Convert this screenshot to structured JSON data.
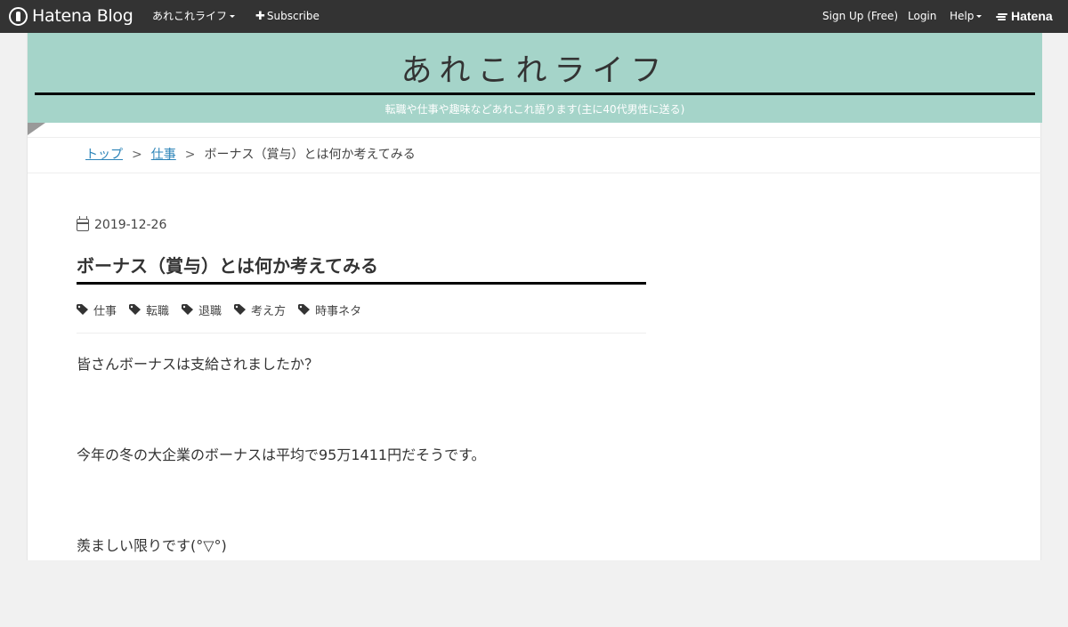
{
  "topbar": {
    "logo_text": "Hatena Blog",
    "blog_menu_label": "あれこれライフ",
    "subscribe_label": "Subscribe",
    "signup_label": "Sign Up (Free)",
    "login_label": "Login",
    "help_label": "Help",
    "brand_label": "Hatena",
    "background_color": "#333333"
  },
  "header": {
    "title": "あれこれライフ",
    "description": "転職や仕事や趣味などあれこれ語ります(主に40代男性に送る)",
    "background_color": "#a5d4c9"
  },
  "breadcrumb": {
    "items": [
      "トップ",
      "仕事"
    ],
    "separator": ">",
    "current": "ボーナス（賞与）とは何か考えてみる",
    "link_color": "#2c84b8"
  },
  "entry": {
    "date": "2019-12-26",
    "title": "ボーナス（賞与）とは何か考えてみる",
    "tags": [
      "仕事",
      "転職",
      "退職",
      "考え方",
      "時事ネタ"
    ],
    "paragraphs": [
      "皆さんボーナスは支給されましたか？",
      "今年の冬の大企業のボーナスは平均で95万1411円だそうです。",
      "羨ましい限りです(°▽°)"
    ]
  }
}
